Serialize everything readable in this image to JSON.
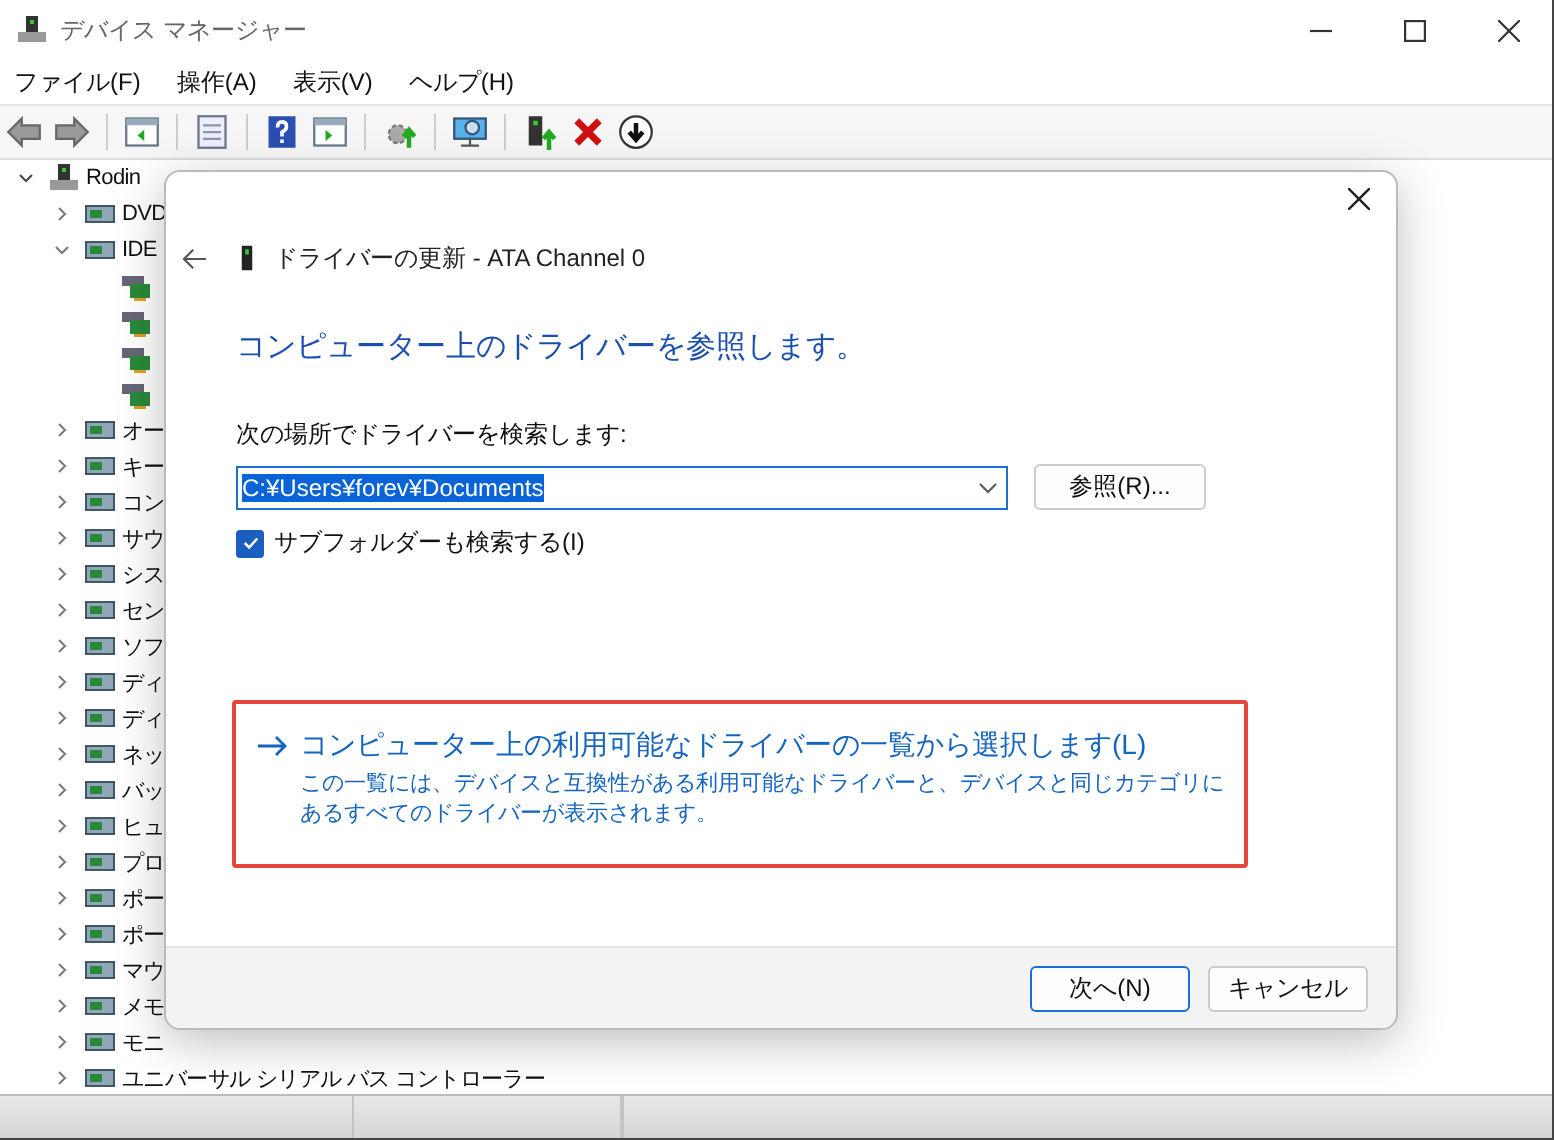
{
  "window": {
    "title": "デバイス マネージャー"
  },
  "menu": [
    "ファイル(F)",
    "操作(A)",
    "表示(V)",
    "ヘルプ(H)"
  ],
  "tree": {
    "label": "Rodin",
    "expanded": true,
    "children": [
      {
        "label": "DVD",
        "expanded": false
      },
      {
        "label": "IDE",
        "expanded": true,
        "children": [
          {
            "kind": "controller"
          },
          {
            "kind": "controller"
          },
          {
            "kind": "controller"
          },
          {
            "kind": "controller"
          }
        ]
      },
      {
        "label": "オー",
        "expanded": false
      },
      {
        "label": "キー",
        "expanded": false
      },
      {
        "label": "コン",
        "expanded": false
      },
      {
        "label": "サウ",
        "expanded": false
      },
      {
        "label": "シス",
        "expanded": false
      },
      {
        "label": "セン",
        "expanded": false
      },
      {
        "label": "ソフ",
        "expanded": false
      },
      {
        "label": "ディ",
        "expanded": false
      },
      {
        "label": "ディ",
        "expanded": false
      },
      {
        "label": "ネッ",
        "expanded": false
      },
      {
        "label": "バッ",
        "expanded": false
      },
      {
        "label": "ヒュ",
        "expanded": false
      },
      {
        "label": "プロ",
        "expanded": false
      },
      {
        "label": "ポー",
        "expanded": false
      },
      {
        "label": "ポー",
        "expanded": false
      },
      {
        "label": "マウ",
        "expanded": false
      },
      {
        "label": "メモ",
        "expanded": false
      },
      {
        "label": "モニ",
        "expanded": false
      },
      {
        "label": "ユニバーサル シリアル バス コントローラー",
        "expanded": false
      }
    ]
  },
  "dialog": {
    "title": "ドライバーの更新 - ATA Channel 0",
    "heading": "コンピューター上のドライバーを参照します。",
    "location_label": "次の場所でドライバーを検索します:",
    "path_field": {
      "value": "C:¥Users¥forev¥Documents"
    },
    "browse_button": "参照(R)...",
    "subfolders": {
      "label": "サブフォルダーも検索する(I)",
      "checked": true
    },
    "pick_option": {
      "title": "コンピューター上の利用可能なドライバーの一覧から選択します(L)",
      "description": "この一覧には、デバイスと互換性がある利用可能なドライバーと、デバイスと同じカテゴリにあるすべてのドライバーが表示されます。",
      "highlighted": true
    },
    "buttons": [
      {
        "label": "次へ(N)",
        "default": true
      },
      {
        "label": "キャンセル",
        "default": false
      }
    ]
  }
}
